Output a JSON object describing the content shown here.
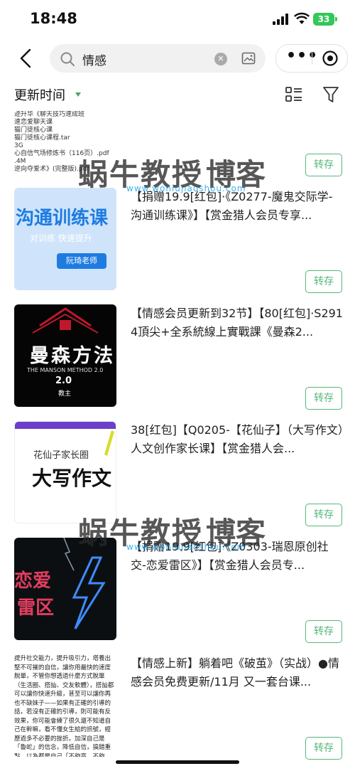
{
  "status_bar": {
    "time": "18:48",
    "battery": "33"
  },
  "search": {
    "query": "情感"
  },
  "filter": {
    "sort_label": "更新时间"
  },
  "items": [
    {
      "title": "",
      "button": "转存",
      "thumb_lines": [
        "迹升华《聊天技巧速成班",
        "速恋爱聊天课",
        "猫门徒核心课",
        "猫门徒核心课程.tar",
        "3G",
        "心自信气场修炼书（116页）.pdf",
        ".4M",
        "逆向夺爱术》(完整版).pdf"
      ]
    },
    {
      "title": "【捐赠19.9[红包]·《Z0277-魔鬼交际学-沟通训练课》】【赏金猎人会员专享...",
      "button": "转存",
      "thumb_big": "沟通训练课",
      "thumb_sub": "对训练 快速提升",
      "thumb_author": "阮琦老师"
    },
    {
      "title": "【情感会员更新到32节】【80[红包]·S2914頂尖+全系統線上實戰課《曼森2...",
      "button": "转存",
      "thumb_big": "曼森方法",
      "thumb_en": "THE MANSON METHOD 2.0",
      "thumb_ver": "2.0",
      "thumb_edu": "教主"
    },
    {
      "title": "38[红包]【Q0205-【花仙子】（大写作文）人文创作家长课】【赏金猎人会...",
      "button": "转存",
      "thumb_small": "花仙子家长圈",
      "thumb_big": "大写作文"
    },
    {
      "title": "【捐赠19.9[红包]·《Z0303-瑞恩原创社交-恋爱雷区》】【赏金猎人会员专...",
      "button": "转存",
      "thumb_big1": "恋爱",
      "thumb_big2": "雷区"
    },
    {
      "title": "【情感上新】躺着吧《破茧》（实战）●情感会员免费更新/11月 又一套台课...",
      "button": "转存",
      "thumb_text": "提升社交能力，提升吸引力，塔養出堅不可摧的自信，讓你用最快的速度脫單，不管你想透過什麼方式脫單（生活圈、搭訕、交友軟體），搭訕都可以讓你快速升級，甚至可以讓你再也不缺妹子——如果有正確的引導的話，若沒有正確的引導，則可能有反效果，你可能會練了很久還不知道自己在幹嘛，看不懂女生給的訊號，經歷過多不必要的挫折。加深自己是「魯蛇」的信念，降低自信，搞錯重點，以為都是自己「不夠高、不夠帥、不夠有錢」，最後甚至放棄搭訕這個幾乎等於外掛的把妹方法。"
    }
  ],
  "watermark": {
    "brand_a": "蜗牛教授",
    "brand_b": "博客",
    "site": "www.woniujiaoshou.com"
  }
}
